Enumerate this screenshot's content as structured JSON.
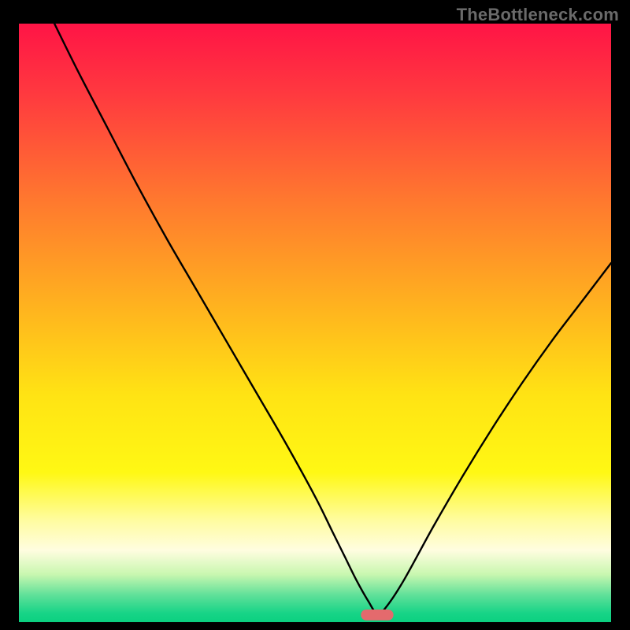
{
  "watermark": "TheBottleneck.com",
  "chart_data": {
    "type": "line",
    "title": "",
    "xlabel": "",
    "ylabel": "",
    "xlim": [
      0,
      100
    ],
    "ylim": [
      0,
      100
    ],
    "grid": false,
    "legend": false,
    "background_gradient": {
      "stops": [
        {
          "offset": 0.0,
          "color": "#ff1446"
        },
        {
          "offset": 0.12,
          "color": "#ff3a3f"
        },
        {
          "offset": 0.3,
          "color": "#ff7a2e"
        },
        {
          "offset": 0.48,
          "color": "#ffb51e"
        },
        {
          "offset": 0.62,
          "color": "#ffe314"
        },
        {
          "offset": 0.75,
          "color": "#fff814"
        },
        {
          "offset": 0.83,
          "color": "#fffca0"
        },
        {
          "offset": 0.88,
          "color": "#fffde0"
        },
        {
          "offset": 0.92,
          "color": "#c9f7b0"
        },
        {
          "offset": 0.955,
          "color": "#5fe099"
        },
        {
          "offset": 0.985,
          "color": "#17d487"
        },
        {
          "offset": 1.0,
          "color": "#0bd080"
        }
      ]
    },
    "series": [
      {
        "name": "curve",
        "x": [
          6,
          10,
          15,
          20,
          25,
          30,
          35,
          40,
          45,
          50,
          53,
          55,
          57,
          59,
          60.5,
          62,
          65,
          70,
          75,
          80,
          85,
          90,
          95,
          100
        ],
        "y": [
          100,
          92,
          82.5,
          73,
          64,
          55.5,
          47,
          38.5,
          30,
          21,
          15,
          11,
          7,
          3.5,
          1.4,
          2.5,
          7,
          16,
          24.5,
          32.5,
          40,
          47,
          53.5,
          60
        ]
      }
    ],
    "marker": {
      "shape": "capsule",
      "x": 60.5,
      "y": 1.2,
      "w": 5.5,
      "h": 1.8,
      "color": "#e46a6d"
    }
  }
}
